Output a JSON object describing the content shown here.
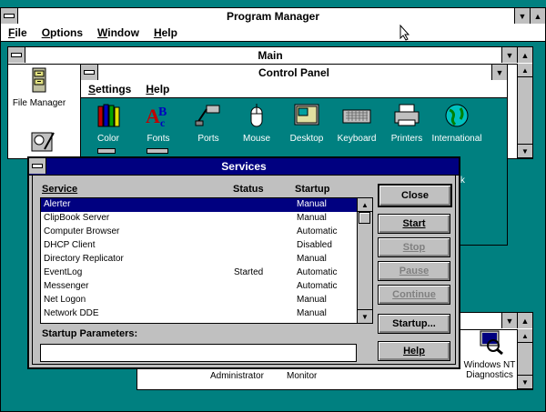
{
  "program_manager": {
    "title": "Program Manager",
    "menus": [
      "File",
      "Options",
      "Window",
      "Help"
    ]
  },
  "main_group": {
    "title": "Main",
    "icons": [
      {
        "label": "File Manager",
        "icon": "file-cabinet-icon"
      }
    ]
  },
  "control_panel": {
    "title": "Control Panel",
    "menus": [
      "Settings",
      "Help"
    ],
    "icons": [
      {
        "label": "Color",
        "icon": "crayons-icon"
      },
      {
        "label": "Fonts",
        "icon": "fonts-icon"
      },
      {
        "label": "Ports",
        "icon": "plug-icon"
      },
      {
        "label": "Mouse",
        "icon": "mouse-icon"
      },
      {
        "label": "Desktop",
        "icon": "desktop-icon"
      },
      {
        "label": "Keyboard",
        "icon": "keyboard-icon"
      },
      {
        "label": "Printers",
        "icon": "printer-icon"
      },
      {
        "label": "International",
        "icon": "globe-icon"
      }
    ],
    "partial_label": "ork"
  },
  "bottom_group": {
    "labels": [
      "Administrator",
      "Monitor"
    ],
    "diagnostics_label_1": "Windows NT",
    "diagnostics_label_2": "Diagnostics"
  },
  "services_dialog": {
    "title": "Services",
    "headers": {
      "service": "Service",
      "status": "Status",
      "startup": "Startup"
    },
    "services": [
      {
        "name": "Alerter",
        "status": "",
        "startup": "Manual",
        "selected": true
      },
      {
        "name": "ClipBook Server",
        "status": "",
        "startup": "Manual"
      },
      {
        "name": "Computer Browser",
        "status": "",
        "startup": "Automatic"
      },
      {
        "name": "DHCP Client",
        "status": "",
        "startup": "Disabled"
      },
      {
        "name": "Directory Replicator",
        "status": "",
        "startup": "Manual"
      },
      {
        "name": "EventLog",
        "status": "Started",
        "startup": "Automatic"
      },
      {
        "name": "Messenger",
        "status": "",
        "startup": "Automatic"
      },
      {
        "name": "Net Logon",
        "status": "",
        "startup": "Manual"
      },
      {
        "name": "Network DDE",
        "status": "",
        "startup": "Manual"
      }
    ],
    "startup_params_label": "Startup Parameters:",
    "startup_params_value": "",
    "buttons": {
      "close": "Close",
      "start": "Start",
      "stop": "Stop",
      "pause": "Pause",
      "continue": "Continue",
      "startup": "Startup...",
      "help": "Help"
    }
  },
  "colors": {
    "desktop": "#008080",
    "title_active": "#000080",
    "selection": "#000080"
  }
}
